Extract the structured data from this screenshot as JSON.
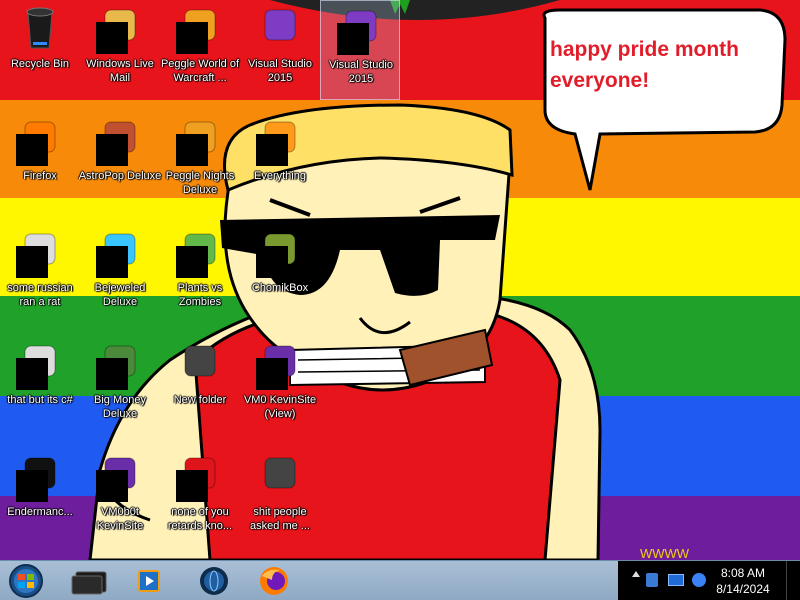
{
  "bubble": {
    "text": "happy pride month everyone!"
  },
  "icons": [
    {
      "label": "Recycle Bin",
      "icon": "recycle-bin-icon"
    },
    {
      "label": "Windows Live Mail",
      "icon": "mail-icon"
    },
    {
      "label": "Peggle World of Warcraft ...",
      "icon": "peggle-icon"
    },
    {
      "label": "Visual Studio 2015",
      "icon": "visual-studio-icon"
    },
    {
      "label": "Visual Studio 2015",
      "icon": "visual-studio-icon"
    },
    {
      "label": "Firefox",
      "icon": "firefox-icon"
    },
    {
      "label": "AstroPop Deluxe",
      "icon": "game-icon"
    },
    {
      "label": "Peggle Nights Deluxe",
      "icon": "peggle-icon"
    },
    {
      "label": "Everything",
      "icon": "search-icon"
    },
    {
      "label": "some russian ran a rat",
      "icon": "app-icon"
    },
    {
      "label": "Bejeweled Deluxe",
      "icon": "gem-icon"
    },
    {
      "label": "Plants vs Zombies",
      "icon": "plant-icon"
    },
    {
      "label": "ChomikBox",
      "icon": "hamster-icon"
    },
    {
      "label": "that but its c#",
      "icon": "app-icon"
    },
    {
      "label": "Big Money Deluxe",
      "icon": "money-icon"
    },
    {
      "label": "New folder",
      "icon": "folder-icon"
    },
    {
      "label": "VM0 KevinSite (View)",
      "icon": "solution-icon"
    },
    {
      "label": "Endermanc...",
      "icon": "terminal-icon"
    },
    {
      "label": "VM0b0t KevinSite",
      "icon": "solution-icon"
    },
    {
      "label": "none of you retards kno...",
      "icon": "opera-icon"
    },
    {
      "label": "shit people asked me ...",
      "icon": "folder-icon"
    }
  ],
  "taskbar": {
    "buttons": [
      "explorer",
      "media-player",
      "app",
      "firefox"
    ],
    "clock_time": "8:08 AM",
    "clock_date": "8/14/2024"
  },
  "colors": {
    "red": "#e8141b",
    "orange": "#f88a0a",
    "yellow": "#fff700",
    "green": "#20a12a",
    "blue": "#1f5bf0",
    "purple": "#6e1e9c"
  }
}
